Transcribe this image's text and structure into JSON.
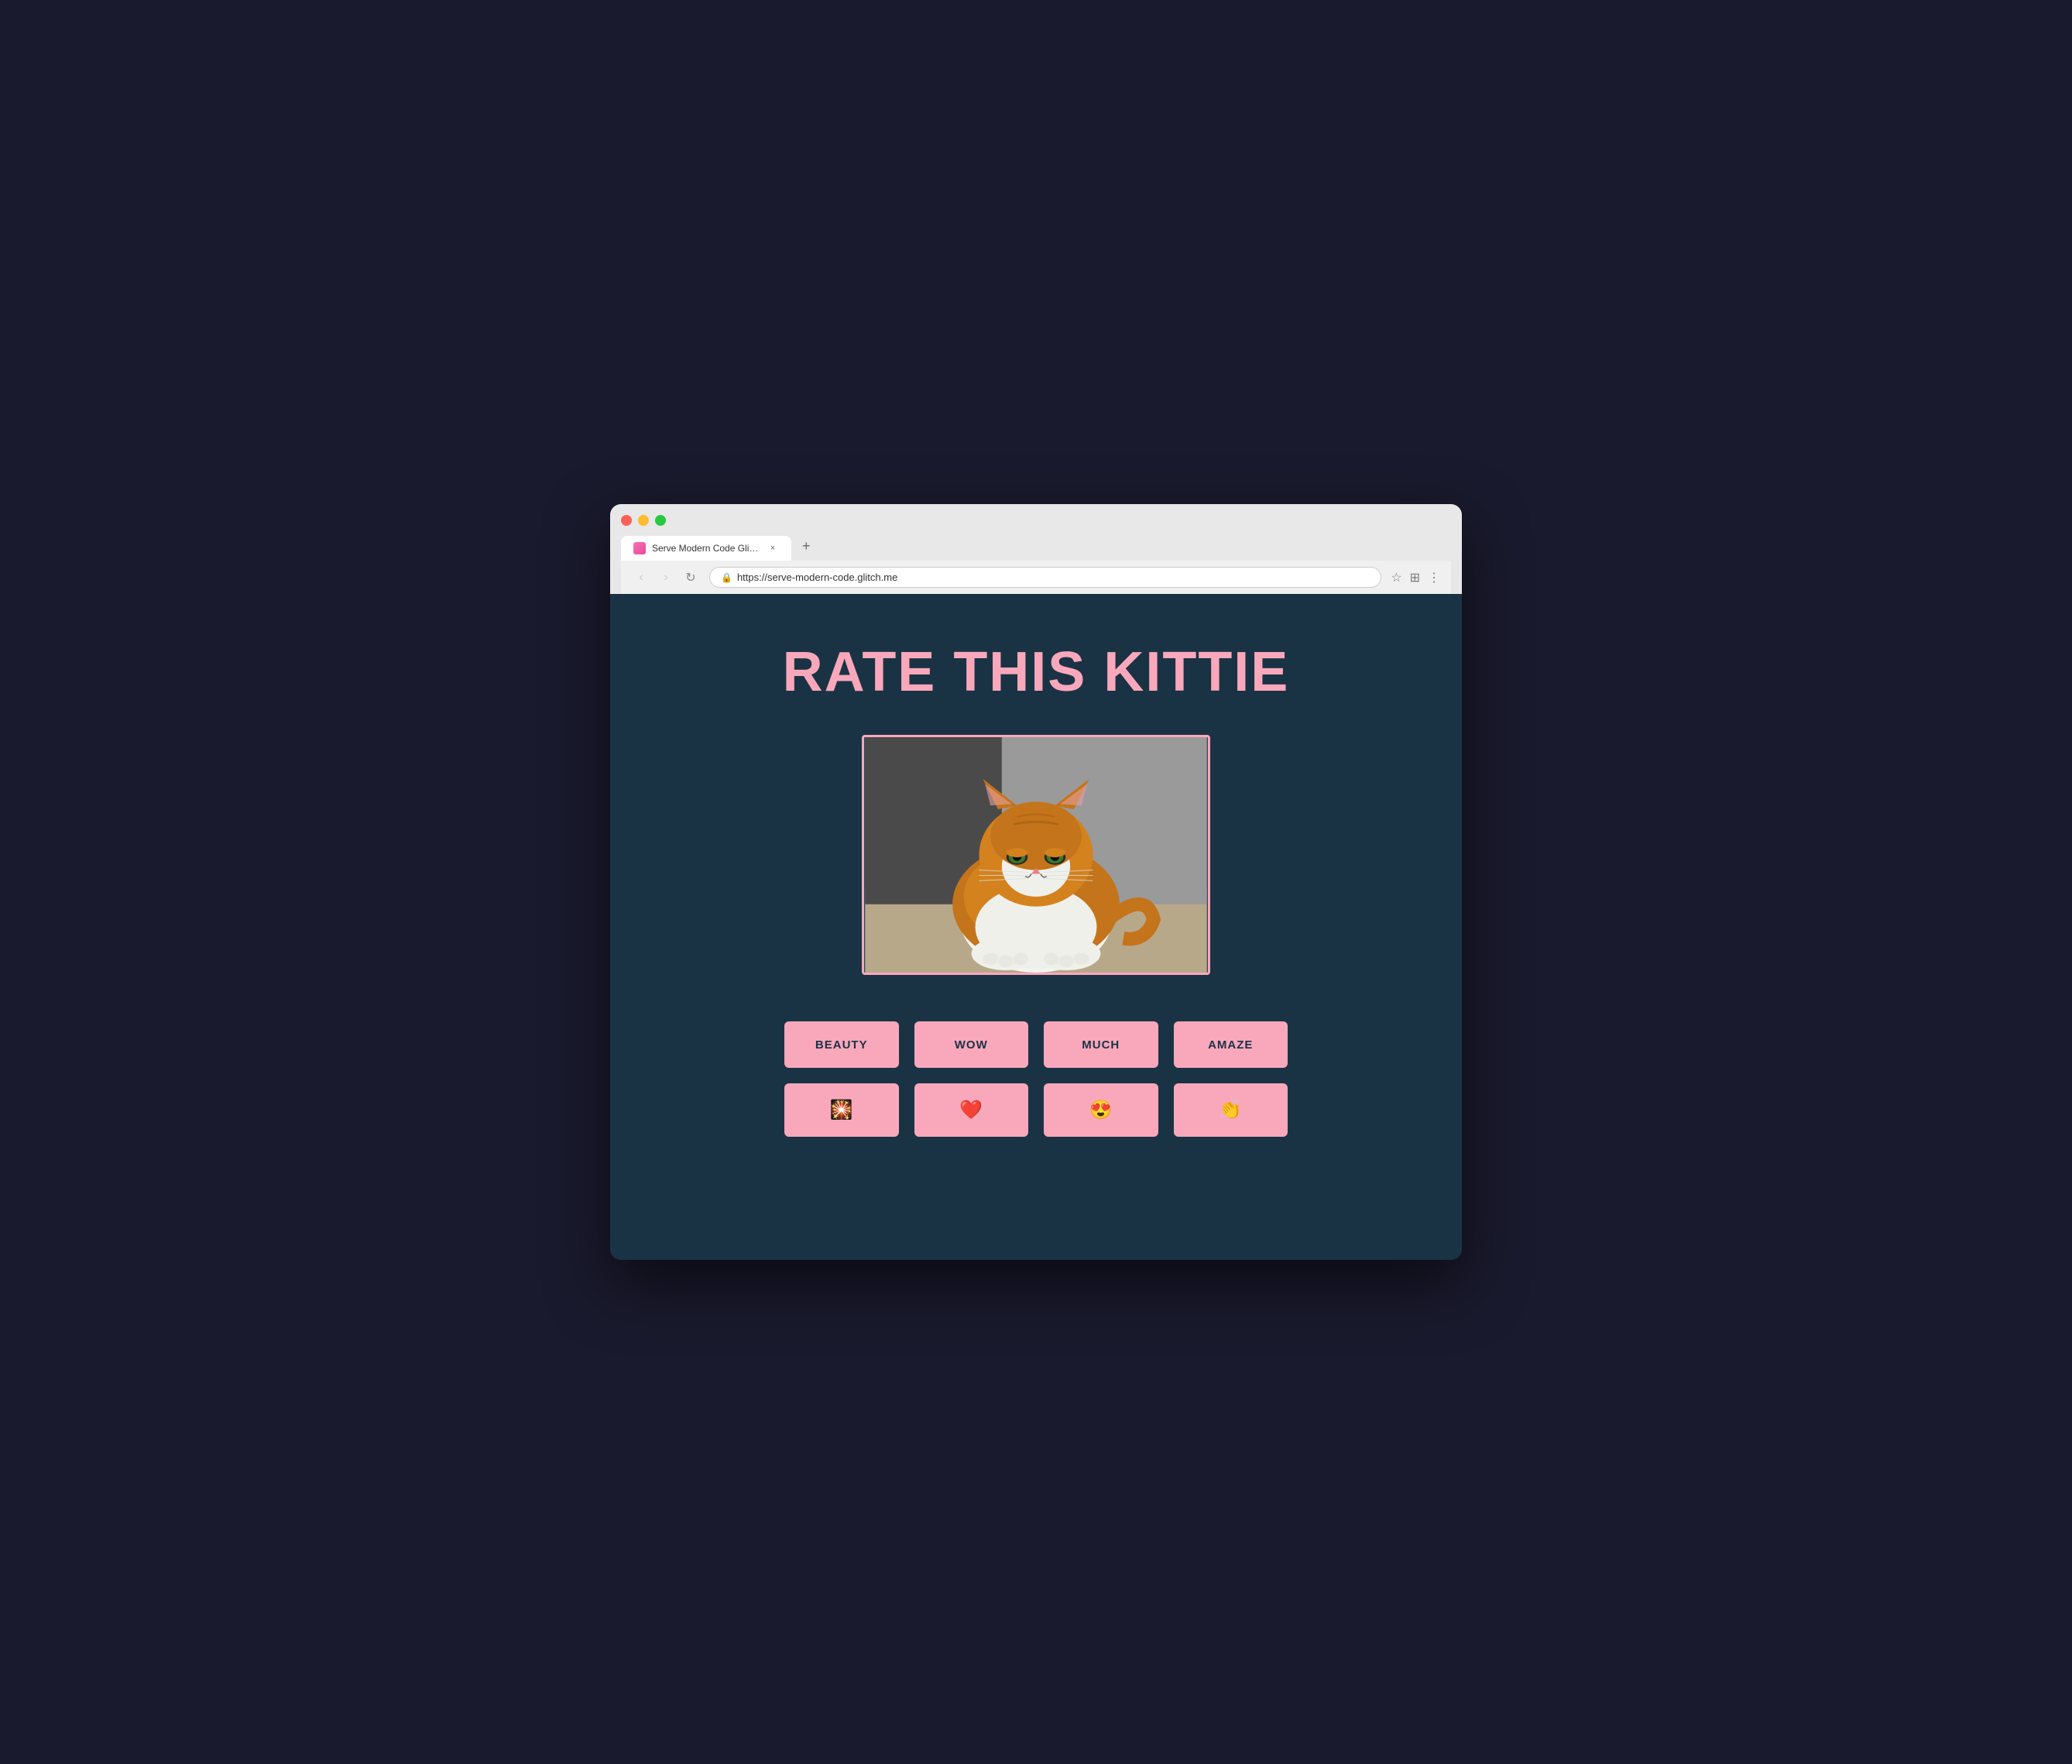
{
  "browser": {
    "tab_title": "Serve Modern Code Glitch Pla",
    "tab_close": "×",
    "tab_new": "+",
    "url": "https://serve-modern-code.glitch.me",
    "nav": {
      "back": "‹",
      "forward": "›",
      "refresh": "↻"
    },
    "toolbar": {
      "star": "☆",
      "extensions": "⊞",
      "menu": "⋮"
    }
  },
  "page": {
    "title": "RATE THIS KITTIE",
    "buttons_row1": [
      {
        "id": "beauty",
        "label": "BEAUTY"
      },
      {
        "id": "wow",
        "label": "WOW"
      },
      {
        "id": "much",
        "label": "MUCH"
      },
      {
        "id": "amaze",
        "label": "AMAZE"
      }
    ],
    "buttons_row2": [
      {
        "id": "sparkle",
        "emoji": "🎇"
      },
      {
        "id": "heart",
        "emoji": "❤️"
      },
      {
        "id": "star-eyes",
        "emoji": "😍"
      },
      {
        "id": "clap",
        "emoji": "👏"
      }
    ]
  }
}
